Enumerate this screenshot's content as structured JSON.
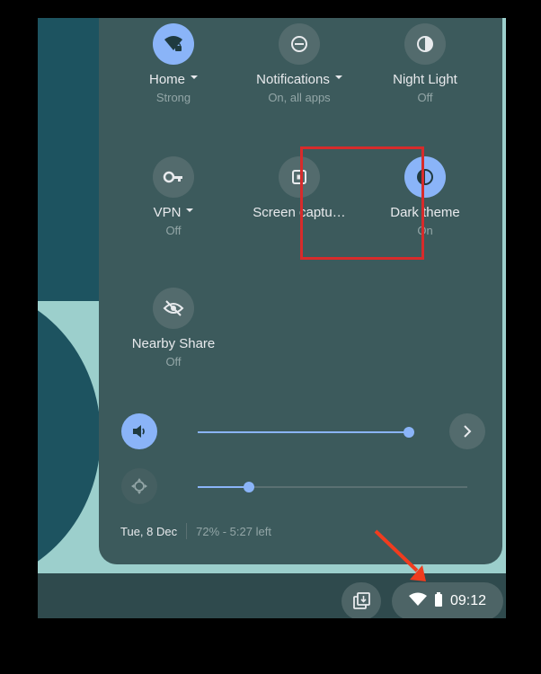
{
  "tiles": [
    {
      "label": "Home",
      "sub": "Strong",
      "icon": "wifi-lock-icon",
      "on": true,
      "caret": true
    },
    {
      "label": "Notifications",
      "sub": "On, all apps",
      "icon": "do-not-disturb-icon",
      "on": false,
      "caret": true
    },
    {
      "label": "Night Light",
      "sub": "Off",
      "icon": "night-light-icon",
      "on": false,
      "caret": false
    },
    {
      "label": "VPN",
      "sub": "Off",
      "icon": "vpn-key-icon",
      "on": false,
      "caret": true
    },
    {
      "label": "Screen captu…",
      "sub": "",
      "icon": "screen-capture-icon",
      "on": false,
      "caret": false
    },
    {
      "label": "Dark theme",
      "sub": "On",
      "icon": "dark-theme-icon",
      "on": true,
      "caret": false
    },
    {
      "label": "Nearby Share",
      "sub": "Off",
      "icon": "nearby-share-off-icon",
      "on": false,
      "caret": false
    }
  ],
  "volume": {
    "level": 0.98,
    "icon": "volume-icon"
  },
  "brightness": {
    "level": 0.19,
    "icon": "brightness-icon"
  },
  "footer": {
    "date": "Tue, 8 Dec",
    "battery": "72% - 5:27 left"
  },
  "tray": {
    "time": "09:12"
  },
  "colors": {
    "accent": "#8ab4f8",
    "highlight": "#d72b2b",
    "arrow": "#f03c1e"
  }
}
